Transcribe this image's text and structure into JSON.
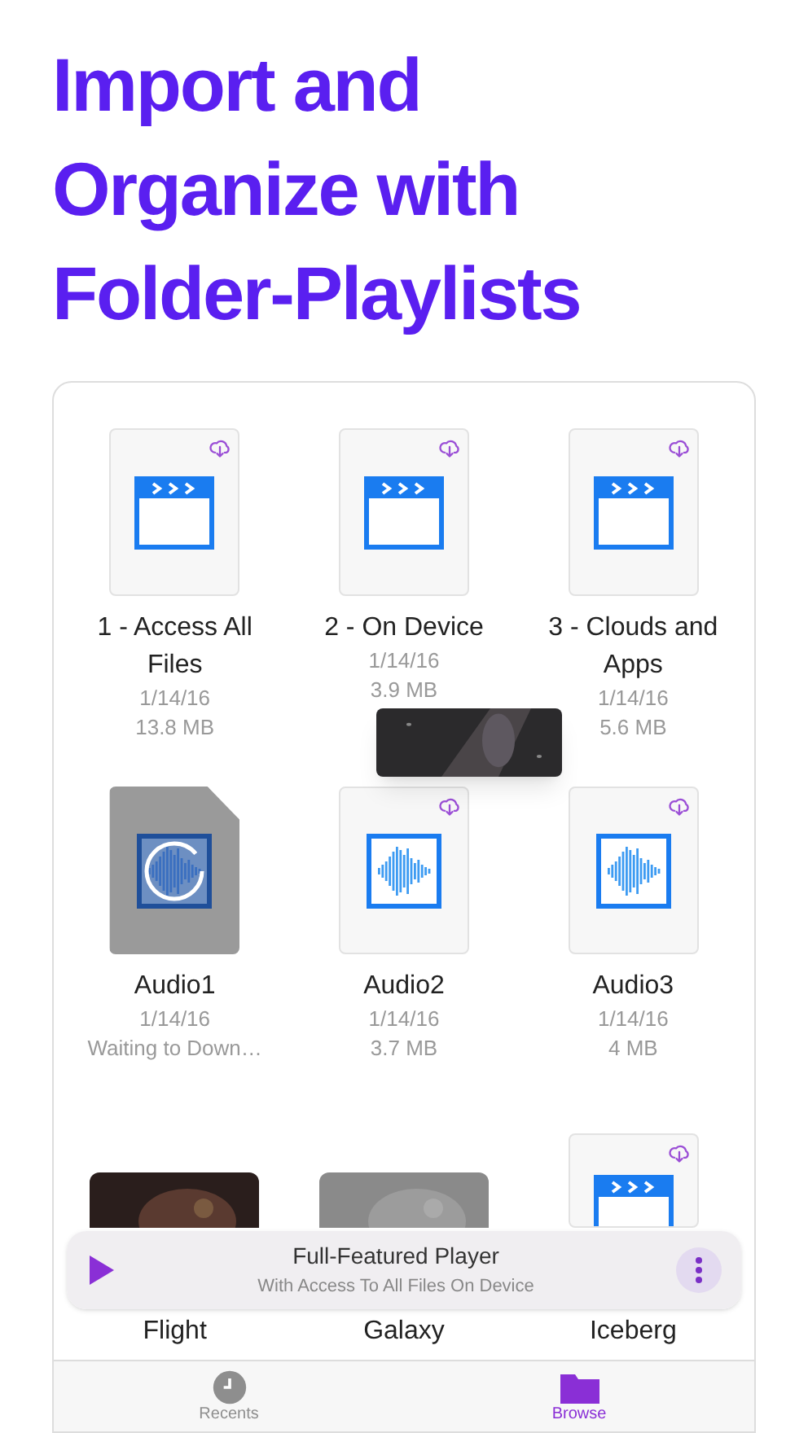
{
  "title_lines": [
    "Import and",
    "Organize with",
    "Folder-Playlists"
  ],
  "files": [
    {
      "name": "1 - Access All Files",
      "kind": "video",
      "cloud": true,
      "downloading": false,
      "details": [
        "1/14/16",
        "13.8 MB"
      ]
    },
    {
      "name": "2 - On Device",
      "kind": "video",
      "cloud": true,
      "downloading": false,
      "details": [
        "1/14/16",
        "3.9 MB"
      ]
    },
    {
      "name": "3 - Clouds and Apps",
      "kind": "video",
      "cloud": true,
      "downloading": false,
      "details": [
        "1/14/16",
        "5.6 MB"
      ]
    },
    {
      "name": "Audio1",
      "kind": "audio",
      "cloud": false,
      "downloading": true,
      "details": [
        "1/14/16",
        "Waiting to Down…"
      ]
    },
    {
      "name": "Audio2",
      "kind": "audio",
      "cloud": true,
      "downloading": false,
      "details": [
        "1/14/16",
        "3.7 MB"
      ]
    },
    {
      "name": "Audio3",
      "kind": "audio",
      "cloud": true,
      "downloading": false,
      "details": [
        "1/14/16",
        "4 MB"
      ]
    },
    {
      "name": "Flight"
    },
    {
      "name": "Galaxy"
    },
    {
      "name": "Iceberg",
      "kind": "video",
      "cloud": true,
      "downloading": false
    }
  ],
  "player": {
    "title": "Full-Featured Player",
    "subtitle": "With Access To All Files On Device"
  },
  "tabs": [
    {
      "label": "Recents",
      "selected": false
    },
    {
      "label": "Browse",
      "selected": true
    }
  ]
}
